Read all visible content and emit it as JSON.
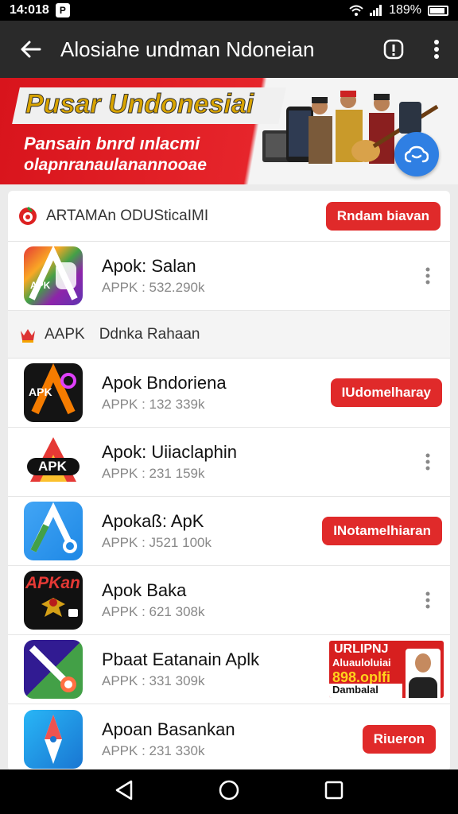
{
  "status_bar": {
    "time": "14:018",
    "battery": "189%"
  },
  "app_bar": {
    "title": "Alosiahe undman Ndoneian"
  },
  "banner": {
    "title": "Pusar Undonesiai",
    "line1": "Pansain bnrd ınlacmi",
    "line2": "olapnranaulanannooae"
  },
  "section_header": {
    "label": "ARTAMAn ODUSticaIMI",
    "button_label": "Rndam biavan"
  },
  "sub_header": {
    "label": "AAPK",
    "label2": "Ddnka Rahaan"
  },
  "apps": [
    {
      "name": "Apok: Salan",
      "meta": "APPK : 532.290k",
      "action": "more"
    },
    {
      "name": "Apok Bndoriena",
      "meta": "APPK : 132 339k",
      "action": "button",
      "button_label": "IUdomelharay"
    },
    {
      "name": "Apok: Uiiaclaphin",
      "meta": "APPK : 231 159k",
      "action": "more"
    },
    {
      "name": "Apokaß: ApK",
      "meta": "APPK : J521 100k",
      "action": "button",
      "button_label": "INotamelhiaran"
    },
    {
      "name": "Apok Baka",
      "meta": "APPK : 621 308k",
      "action": "more"
    },
    {
      "name": "Pbaat Eatanain Aplk",
      "meta": "APPK : 331 309k",
      "action": "ad"
    },
    {
      "name": "Apoan Basankan",
      "meta": "APPK : 231 330k",
      "action": "button",
      "button_label": "Riueron"
    }
  ],
  "icon_texts": {
    "icon1": "APK",
    "icon2": "APK",
    "icon3": "APK",
    "icon5": "APKan"
  },
  "ad": {
    "line1": "URLIPNJ",
    "line2": "Aluauloluiai",
    "line3": "898.oplfi",
    "line4": "Dambalal"
  },
  "colors": {
    "accent_red": "#e02a2a",
    "app_bar": "#2a2a2a",
    "fab_blue": "#2f7fe3"
  }
}
